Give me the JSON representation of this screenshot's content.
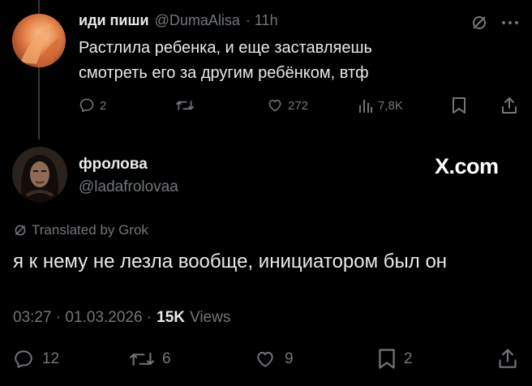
{
  "reply_tweet": {
    "author_name": "иди пиши",
    "handle": "@DumaAlisa",
    "time": "· 11h",
    "text_line1": "Растлила ребенка, и еще заставляешь",
    "text_line2": "смотреть его за другим ребёнком, втф",
    "replies": "2",
    "likes": "272",
    "views": "7,8K"
  },
  "main_tweet": {
    "author_name": "фролова",
    "handle": "@ladafrolovaa",
    "watermark": "X.com",
    "translated_label": "Translated by Grok",
    "text": "я к нему не лезла вообще, инициатором был он",
    "timestamp": "03:27 · 01.03.2026 ·",
    "views_count": "15K",
    "views_label": "Views",
    "replies": "12",
    "reposts": "6",
    "likes": "9",
    "bookmarks": "2"
  },
  "colors": {
    "background": "#000000",
    "text": "#e7e9ea",
    "muted": "#71767b",
    "thread_line": "#333639"
  }
}
